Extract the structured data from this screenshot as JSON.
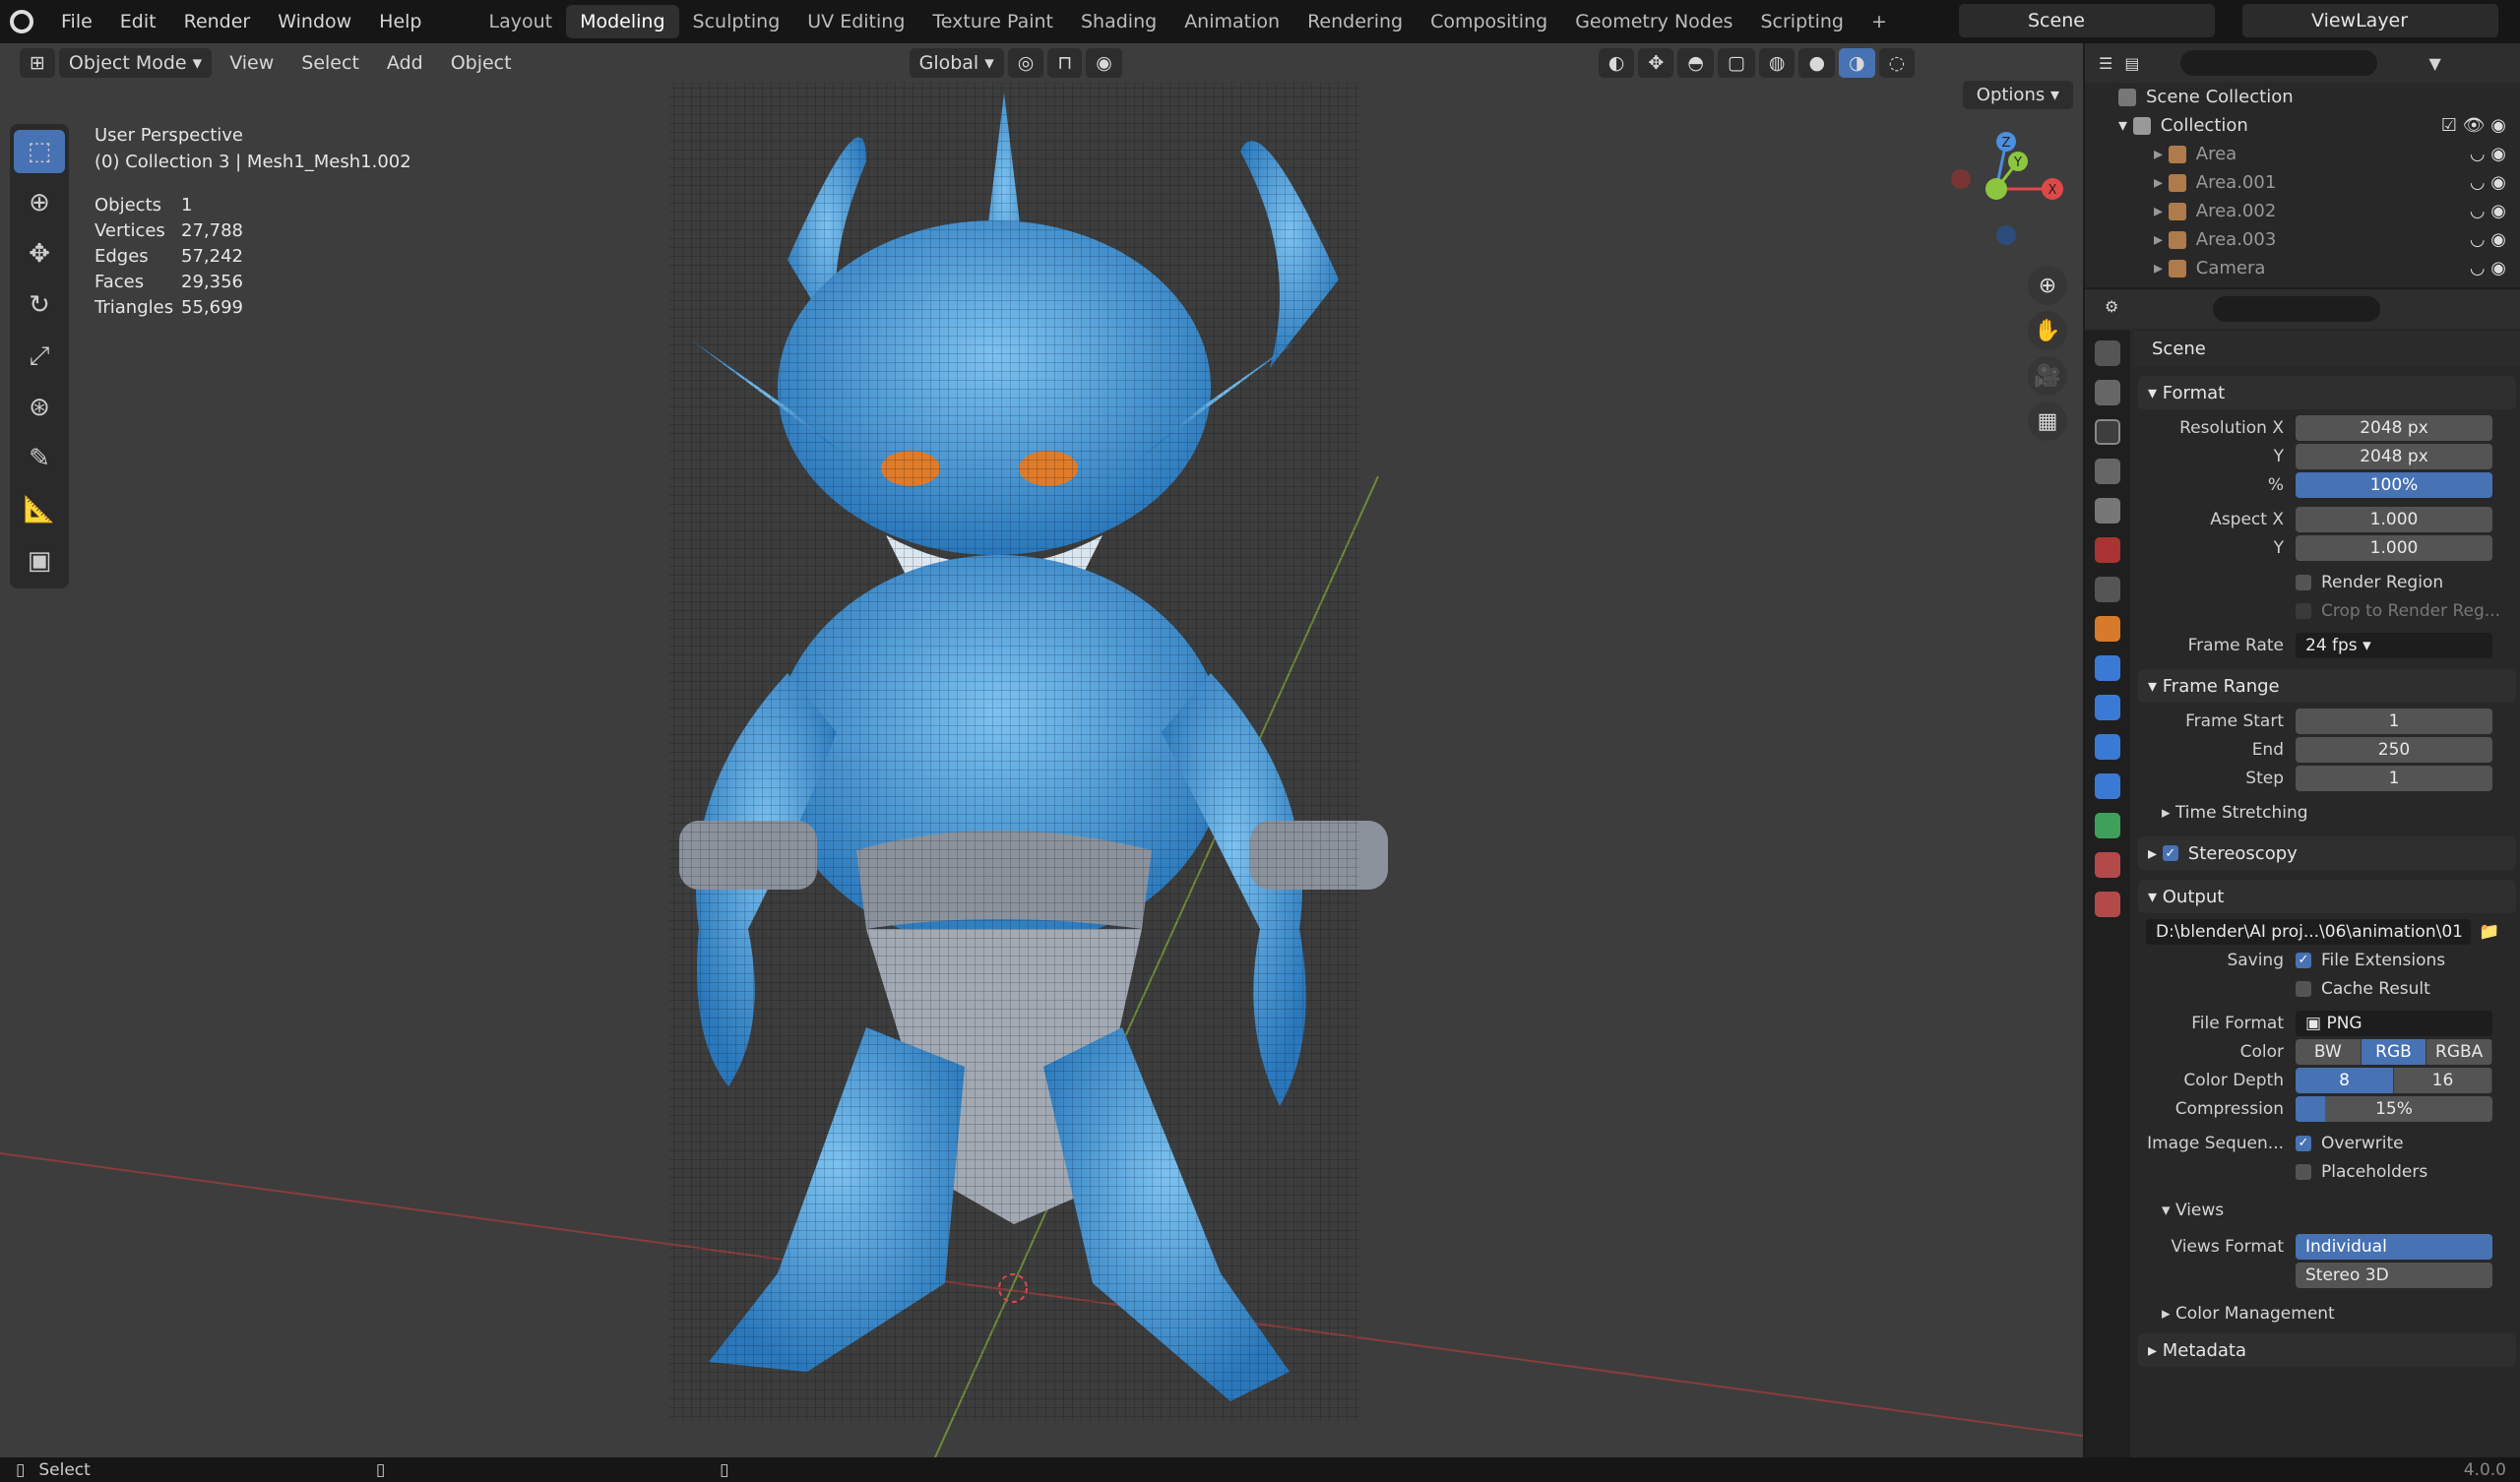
{
  "menu": {
    "items": [
      "File",
      "Edit",
      "Render",
      "Window",
      "Help"
    ]
  },
  "workspaces": {
    "tabs": [
      "Layout",
      "Modeling",
      "Sculpting",
      "UV Editing",
      "Texture Paint",
      "Shading",
      "Animation",
      "Rendering",
      "Compositing",
      "Geometry Nodes",
      "Scripting"
    ],
    "active": "Modeling",
    "add": "+"
  },
  "scene": {
    "name": "Scene",
    "view_layer": "ViewLayer"
  },
  "viewport": {
    "mode": "Object Mode",
    "menus": [
      "View",
      "Select",
      "Add",
      "Object"
    ],
    "transform": "Global",
    "options": "Options",
    "perspective": "User Perspective",
    "collection": "(0) Collection 3 | Mesh1_Mesh1.002",
    "stats": [
      {
        "k": "Objects",
        "v": "1"
      },
      {
        "k": "Vertices",
        "v": "27,788"
      },
      {
        "k": "Edges",
        "v": "57,242"
      },
      {
        "k": "Faces",
        "v": "29,356"
      },
      {
        "k": "Triangles",
        "v": "55,699"
      }
    ],
    "gizmo": {
      "x": "X",
      "y": "Y",
      "z": "Z"
    }
  },
  "outliner": {
    "scene_collection": "Scene Collection",
    "collection": "Collection",
    "items": [
      "Area",
      "Area.001",
      "Area.002",
      "Area.003",
      "Camera"
    ]
  },
  "properties": {
    "title": "Scene",
    "format": {
      "header": "Format",
      "res_x_label": "Resolution X",
      "res_x": "2048 px",
      "res_y_label": "Y",
      "res_y": "2048 px",
      "pct_label": "%",
      "pct": "100%",
      "aspect_x_label": "Aspect X",
      "aspect_x": "1.000",
      "aspect_y_label": "Y",
      "aspect_y": "1.000",
      "render_region": "Render Region",
      "crop": "Crop to Render Reg...",
      "fps_label": "Frame Rate",
      "fps": "24 fps"
    },
    "frame_range": {
      "header": "Frame Range",
      "start_label": "Frame Start",
      "start": "1",
      "end_label": "End",
      "end": "250",
      "step_label": "Step",
      "step": "1",
      "time_stretching": "Time Stretching"
    },
    "stereoscopy": "Stereoscopy",
    "output": {
      "header": "Output",
      "path": "D:\\blender\\AI proj...\\06\\animation\\01",
      "saving_label": "Saving",
      "file_ext": "File Extensions",
      "cache": "Cache Result",
      "format_label": "File Format",
      "format": "PNG",
      "color_label": "Color",
      "color_opts": [
        "BW",
        "RGB",
        "RGBA"
      ],
      "color_sel": "RGB",
      "depth_label": "Color Depth",
      "depth_opts": [
        "8",
        "16"
      ],
      "compression_label": "Compression",
      "compression": "15%",
      "compression_fill": 0.15,
      "imgseq_label": "Image Sequen...",
      "overwrite": "Overwrite",
      "placeholders": "Placeholders"
    },
    "views": {
      "header": "Views",
      "format_label": "Views Format",
      "opts": [
        "Individual",
        "Stereo 3D"
      ]
    },
    "color_management": "Color Management",
    "metadata": "Metadata"
  },
  "status": {
    "select": "Select",
    "version": "4.0.0"
  },
  "colors": {
    "accent": "#4772b3",
    "skin": "#3c8fd0",
    "bg": "#3d3d3d"
  }
}
